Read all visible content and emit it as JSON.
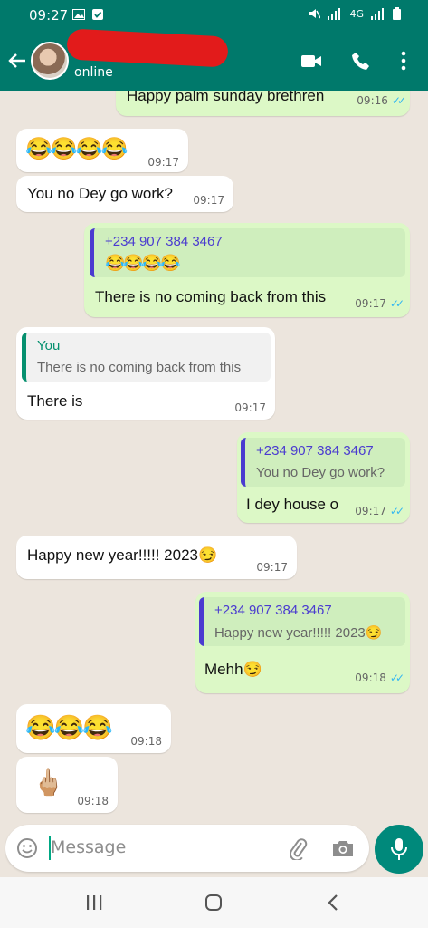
{
  "status_bar": {
    "time": "09:27",
    "network": "4G"
  },
  "header": {
    "status": "online"
  },
  "messages": [
    {
      "text": "Happy palm sunday brethren",
      "time": "09:16"
    },
    {
      "emoji": "😂😂😂😂",
      "time": "09:17"
    },
    {
      "text": "You no Dey go work?",
      "time": "09:17"
    },
    {
      "quote_name": "+234 907 384 3467",
      "quote_text": "😂😂😂😂",
      "text": "There is no coming back from this",
      "time": "09:17"
    },
    {
      "quote_name": "You",
      "quote_text": "There is no coming back from this",
      "text": "There is",
      "time": "09:17"
    },
    {
      "quote_name": "+234 907 384 3467",
      "quote_text": "You no Dey go work?",
      "text": "I dey house o",
      "time": "09:17"
    },
    {
      "text": "Happy new year!!!!! 2023😏",
      "time": "09:17"
    },
    {
      "quote_name": "+234 907 384 3467",
      "quote_text": "Happy new year!!!!! 2023😏",
      "text": "Mehh😏",
      "time": "09:18"
    },
    {
      "emoji": "😂😂😂",
      "time": "09:18"
    },
    {
      "emoji": "🖕🏼",
      "time": "09:18"
    }
  ],
  "input": {
    "placeholder": "Message"
  },
  "colors": {
    "header": "#00796b",
    "outgoing": "#dcf8c6",
    "incoming": "#ffffff",
    "read_tick": "#34b7f1"
  },
  "icons": [
    "back-arrow-icon",
    "video-call-icon",
    "phone-icon",
    "more-icon",
    "emoji-icon",
    "attach-icon",
    "camera-icon",
    "mic-icon",
    "recents-icon",
    "home-icon",
    "nav-back-icon"
  ]
}
